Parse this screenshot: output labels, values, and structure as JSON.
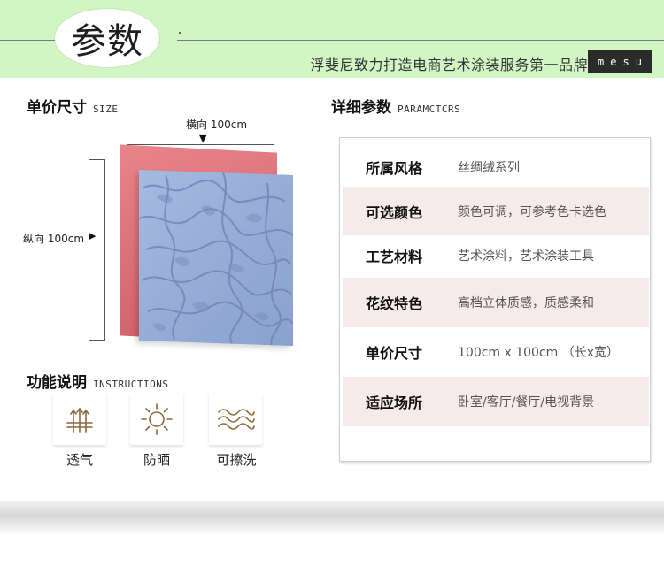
{
  "header": {
    "title": "参数",
    "slogan": "浮斐尼致力打造电商艺术涂装服务第一品牌",
    "brand": "mesu",
    "background_color": "#d2f5c4"
  },
  "size_section": {
    "title": "单价尺寸",
    "subtitle": "SIZE",
    "horizontal_label": "横向 100cm",
    "vertical_label": "纵向 100cm",
    "horizontal_arrow": "▼",
    "vertical_arrow": "▶",
    "front_panel_color": "#93aad8",
    "back_panel_color": "#d76c73"
  },
  "function_section": {
    "title": "功能说明",
    "subtitle": "INSTRUCTIONS",
    "items": [
      {
        "label": "透气",
        "icon": "breathable-icon"
      },
      {
        "label": "防晒",
        "icon": "sun-icon"
      },
      {
        "label": "可擦洗",
        "icon": "waves-icon"
      }
    ]
  },
  "params_section": {
    "title": "详细参数",
    "subtitle": "PARAMCTCRS",
    "rows": [
      {
        "key": "所属风格",
        "value": "丝绸绒系列"
      },
      {
        "key": "可选颜色",
        "value": "颜色可调，可参考色卡选色"
      },
      {
        "key": "工艺材料",
        "value": "艺术涂料，艺术涂装工具"
      },
      {
        "key": "花纹特色",
        "value": "高档立体质感，质感柔和"
      },
      {
        "key": "单价尺寸",
        "value": "100cm x 100cm （长x宽）"
      },
      {
        "key": "适应场所",
        "value": "卧室/客厅/餐厅/电视背景"
      }
    ],
    "shaded_row_color": "#f7eaea",
    "icon_color": "#8a6a3a"
  }
}
